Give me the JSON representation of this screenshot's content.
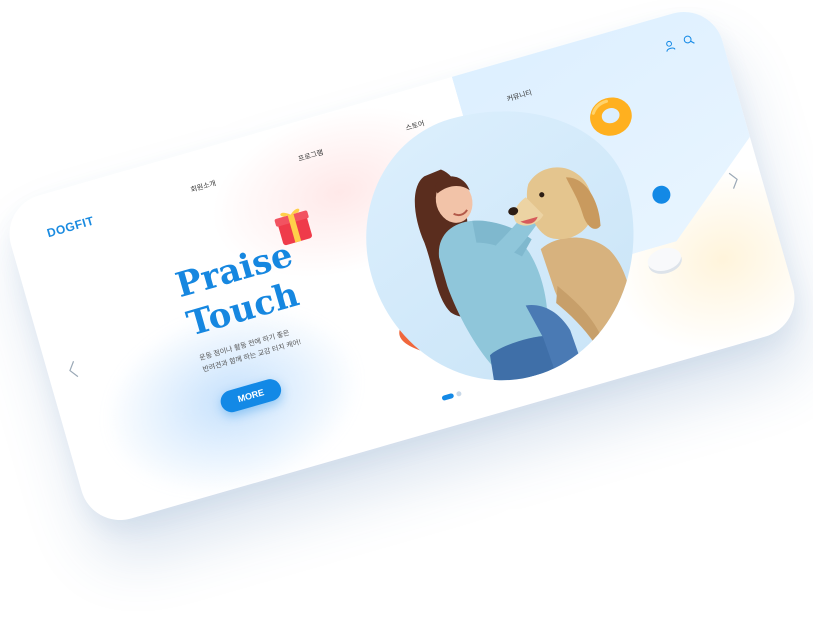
{
  "header": {
    "logo": "DOGFIT",
    "nav": [
      "회원소개",
      "프로그램",
      "스토어",
      "커뮤니티"
    ],
    "icons": [
      "user-icon",
      "search-icon"
    ]
  },
  "hero": {
    "title_line1": "Praise",
    "title_line2": "Touch",
    "subtitle_line1": "운동 점이나 활동 전에 하기 좋은",
    "subtitle_line2": "반려견과 함께 하는 교감 터치 케어!",
    "button_label": "MORE"
  },
  "carousel": {
    "slides": 2,
    "active": 1,
    "prev_icon": "chevron-left-icon",
    "next_icon": "chevron-right-icon"
  },
  "colors": {
    "accent": "#1389e6",
    "title": "#1687e0",
    "photo_bg": "#dceffd"
  }
}
